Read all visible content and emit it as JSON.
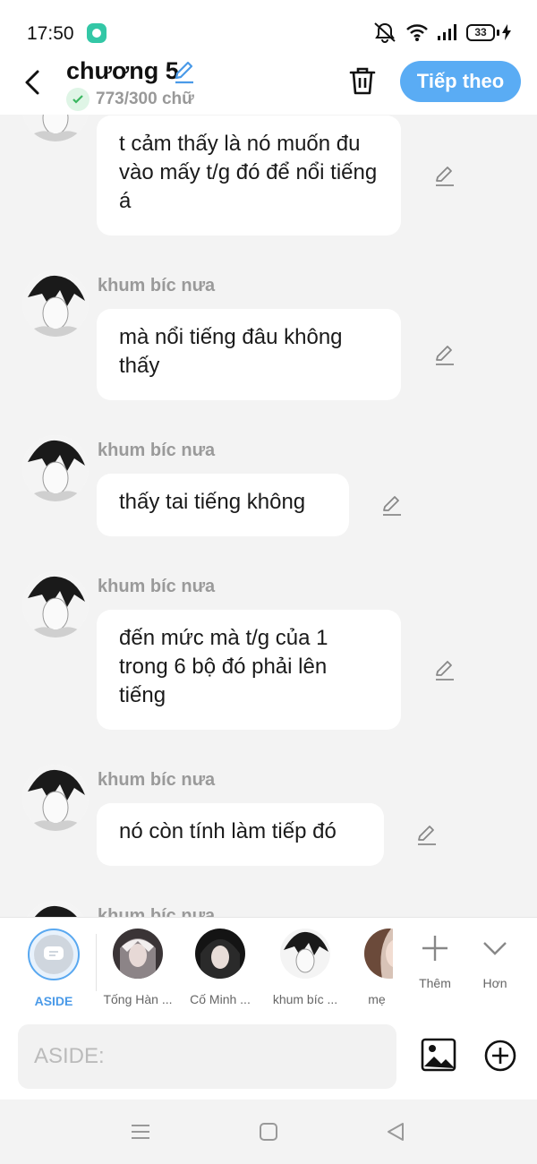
{
  "status_bar": {
    "time": "17:50",
    "battery": "33"
  },
  "header": {
    "title": "chương 5",
    "word_count": "773/300 chữ",
    "next_label": "Tiếp theo"
  },
  "messages": [
    {
      "sender": "",
      "text": "t cảm thấy là nó muốn đu vào mấy t/g đó để nổi tiếng á"
    },
    {
      "sender": "khum bíc nưa",
      "text": "mà nổi tiếng đâu không thấy"
    },
    {
      "sender": "khum bíc nưa",
      "text": "thấy tai tiếng không"
    },
    {
      "sender": "khum bíc nưa",
      "text": "đến mức mà t/g của 1 trong 6 bộ đó phải lên tiếng"
    },
    {
      "sender": "khum bíc nưa",
      "text": "nó còn tính làm tiếp đó"
    },
    {
      "sender": "khum bíc nưa",
      "text": ""
    }
  ],
  "characters": {
    "aside": "ASIDE",
    "list": [
      "Tống Hàn ...",
      "Cố Minh ...",
      "khum bíc ...",
      "mẹ"
    ],
    "add_label": "Thêm",
    "more_label": "Hơn"
  },
  "input": {
    "placeholder": "ASIDE:"
  },
  "colors": {
    "accent": "#5aacf4",
    "background": "#f3f3f3",
    "bubble": "#ffffff"
  }
}
